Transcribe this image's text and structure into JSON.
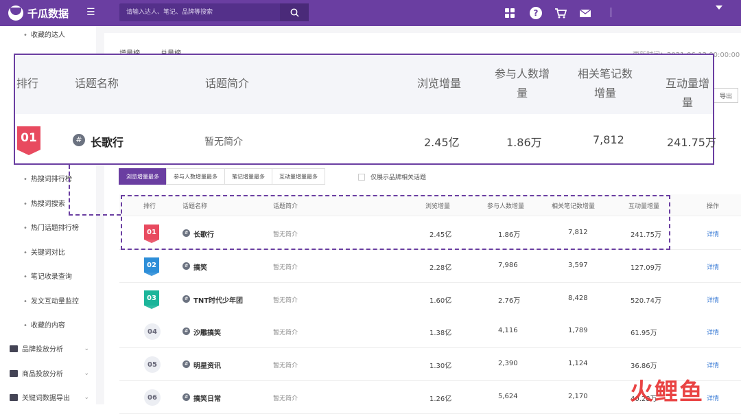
{
  "brand": {
    "name": "千瓜数据"
  },
  "search": {
    "placeholder": "请输入达人、笔记、品牌等搜索"
  },
  "sidebar": {
    "top_item": "收藏的达人",
    "sub_items": [
      "热搜词排行榜",
      "热搜词搜索",
      "热门话题排行榜",
      "关键词对比",
      "笔记收录查询",
      "发文互动量监控",
      "收藏的内容"
    ],
    "main_items": [
      "品牌投放分析",
      "商品投放分析",
      "关键词数据导出"
    ]
  },
  "content": {
    "tab_increase": "增量榜",
    "tab_total": "总量榜",
    "update_time": "更新时间：2021-06-12 00:00:00",
    "export_label": "导出"
  },
  "filters": {
    "buttons": [
      "浏览增量最多",
      "参与人数增量最多",
      "笔记增量最多",
      "互动量增量最多"
    ],
    "brand_only": "仅展示品牌相关话题"
  },
  "table": {
    "headers": {
      "rank": "排行",
      "name": "话题名称",
      "intro": "话题简介",
      "views": "浏览增量",
      "participants": "参与人数增量",
      "notes": "相关笔记数增量",
      "interactions": "互动量增量",
      "action": "操作"
    },
    "rows": [
      {
        "rank": "01",
        "name": "长歌行",
        "intro": "暂无简介",
        "views": "2.45亿",
        "participants": "1.86万",
        "notes": "7,812",
        "interactions": "241.75万",
        "action": "详情"
      },
      {
        "rank": "02",
        "name": "搞笑",
        "intro": "暂无简介",
        "views": "2.28亿",
        "participants": "7,986",
        "notes": "3,597",
        "interactions": "127.09万",
        "action": "详情"
      },
      {
        "rank": "03",
        "name": "TNT时代少年团",
        "intro": "暂无简介",
        "views": "1.60亿",
        "participants": "2.76万",
        "notes": "8,428",
        "interactions": "520.74万",
        "action": "详情"
      },
      {
        "rank": "04",
        "name": "沙雕搞笑",
        "intro": "暂无简介",
        "views": "1.38亿",
        "participants": "4,116",
        "notes": "1,789",
        "interactions": "61.95万",
        "action": "详情"
      },
      {
        "rank": "05",
        "name": "明星资讯",
        "intro": "暂无简介",
        "views": "1.30亿",
        "participants": "2,390",
        "notes": "1,124",
        "interactions": "36.86万",
        "action": "详情"
      },
      {
        "rank": "06",
        "name": "搞笑日常",
        "intro": "暂无简介",
        "views": "1.26亿",
        "participants": "5,624",
        "notes": "2,170",
        "interactions": "40.28万",
        "action": "详情"
      }
    ]
  },
  "zoom": {
    "headers": {
      "rank": "排行",
      "name": "话题名称",
      "intro": "话题简介",
      "views": "浏览增量",
      "participants": "参与人数增量",
      "notes": "相关笔记数增量",
      "interactions": "互动量增量"
    },
    "row": {
      "rank": "01",
      "name": "长歌行",
      "intro": "暂无简介",
      "views": "2.45亿",
      "participants": "1.86万",
      "notes": "7,812",
      "interactions": "241.75万"
    }
  },
  "watermark": {
    "text": "火鲤鱼"
  },
  "colors": {
    "primary": "#6a3ea1",
    "rank1": "#e84a5f",
    "rank2": "#2d8ed8",
    "rank3": "#1bb59a",
    "link": "#3a7bd5"
  }
}
